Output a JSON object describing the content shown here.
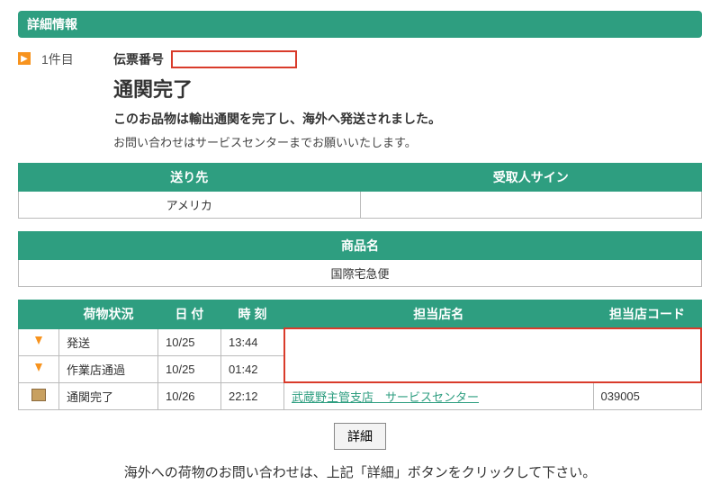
{
  "header": "詳細情報",
  "item": {
    "count": "1件目",
    "slip_label": "伝票番号",
    "slip_number": "",
    "status_title": "通関完了",
    "status_desc": "このお品物は輸出通関を完了し、海外へ発送されました。",
    "status_note": "お問い合わせはサービスセンターまでお願いいたします。"
  },
  "dest_table": {
    "headers": [
      "送り先",
      "受取人サイン"
    ],
    "row": [
      "アメリカ",
      ""
    ]
  },
  "product_table": {
    "header": "商品名",
    "value": "国際宅急便"
  },
  "track_table": {
    "headers": [
      "",
      "荷物状況",
      "日 付",
      "時 刻",
      "担当店名",
      "担当店コード"
    ],
    "rows": [
      {
        "icon": "arrow",
        "status": "発送",
        "date": "10/25",
        "time": "13:44",
        "store": "",
        "code": "",
        "redacted": true
      },
      {
        "icon": "arrow",
        "status": "作業店通過",
        "date": "10/25",
        "time": "01:42",
        "store": "",
        "code": "",
        "redacted": true
      },
      {
        "icon": "box",
        "status": "通関完了",
        "date": "10/26",
        "time": "22:12",
        "store": "武蔵野主管支店　サービスセンター",
        "code": "039005",
        "redacted": false,
        "store_link": true
      }
    ]
  },
  "button": "詳細",
  "footer": "海外への荷物のお問い合わせは、上記「詳細」ボタンをクリックして下さい。"
}
